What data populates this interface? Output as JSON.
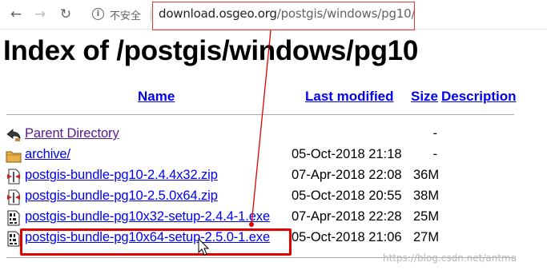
{
  "browser": {
    "back_glyph": "←",
    "forward_glyph": "→",
    "reload_glyph": "↻",
    "info_glyph": "i",
    "insecure_label": "不安全",
    "url_host": "download.osgeo.org",
    "url_path": "/postgis/windows/pg10/"
  },
  "page": {
    "title": "Index of /postgis/windows/pg10"
  },
  "table": {
    "headers": {
      "name": "Name",
      "last_modified": "Last modified",
      "size": "Size",
      "description": "Description"
    },
    "rows": [
      {
        "icon": "back-arrow-icon",
        "name": "Parent Directory",
        "date": "",
        "size": "-"
      },
      {
        "icon": "folder-icon",
        "name": "archive/",
        "date": "05-Oct-2018 21:18",
        "size": "-"
      },
      {
        "icon": "compressed-file-icon",
        "name": "postgis-bundle-pg10-2.4.4x32.zip",
        "date": "07-Apr-2018 22:08",
        "size": "36M"
      },
      {
        "icon": "compressed-file-icon",
        "name": "postgis-bundle-pg10-2.5.0x64.zip",
        "date": "05-Oct-2018 20:55",
        "size": "38M"
      },
      {
        "icon": "binary-file-icon",
        "name": "postgis-bundle-pg10x32-setup-2.4.4-1.exe",
        "date": "07-Apr-2018 22:28",
        "size": "25M"
      },
      {
        "icon": "binary-file-icon",
        "name": "postgis-bundle-pg10x64-setup-2.5.0-1.exe",
        "date": "05-Oct-2018 21:06",
        "size": "27M"
      }
    ]
  },
  "annotation": {
    "color": "#e00000"
  },
  "watermark": "https://blog.csdn.net/antma"
}
